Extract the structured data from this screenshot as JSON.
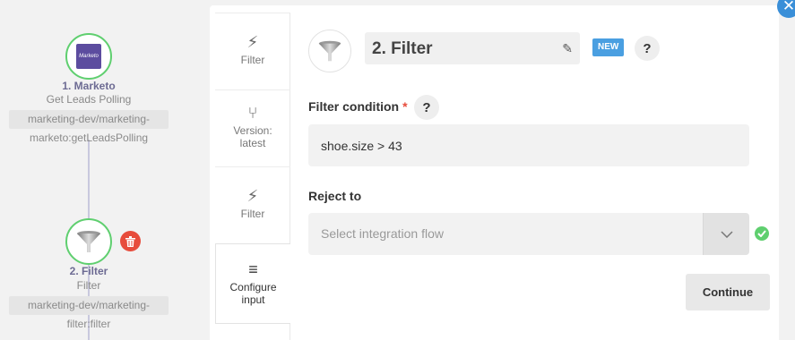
{
  "flow": {
    "nodes": [
      {
        "title": "1. Marketo",
        "subtitle": "Get Leads Polling",
        "path_lines": [
          "marketing-dev/marketing-",
          "marketo:getLeadsPolling"
        ],
        "logo_text": "Marketo"
      },
      {
        "title": "2. Filter",
        "subtitle": "Filter",
        "path_lines": [
          "marketing-dev/marketing-",
          "filter:filter"
        ]
      }
    ]
  },
  "tabs": [
    {
      "icon": "⚡",
      "label": "Filter"
    },
    {
      "icon": "⑂",
      "label": "Version:",
      "label2": "latest"
    },
    {
      "icon": "⚡",
      "label": "Filter"
    },
    {
      "icon": "≡",
      "label": "Configure",
      "label2": "input"
    }
  ],
  "header": {
    "title": "2. Filter",
    "badge": "NEW",
    "help": "?"
  },
  "form": {
    "filter_condition_label": "Filter condition",
    "required_mark": "*",
    "help": "?",
    "filter_condition_value": "shoe.size > 43",
    "reject_to_label": "Reject to",
    "reject_to_placeholder": "Select integration flow",
    "continue_label": "Continue"
  },
  "colors": {
    "success": "#5fcf6f",
    "danger": "#e74c3c",
    "accent": "#4a9fe1",
    "marketo": "#5c4c9f"
  }
}
